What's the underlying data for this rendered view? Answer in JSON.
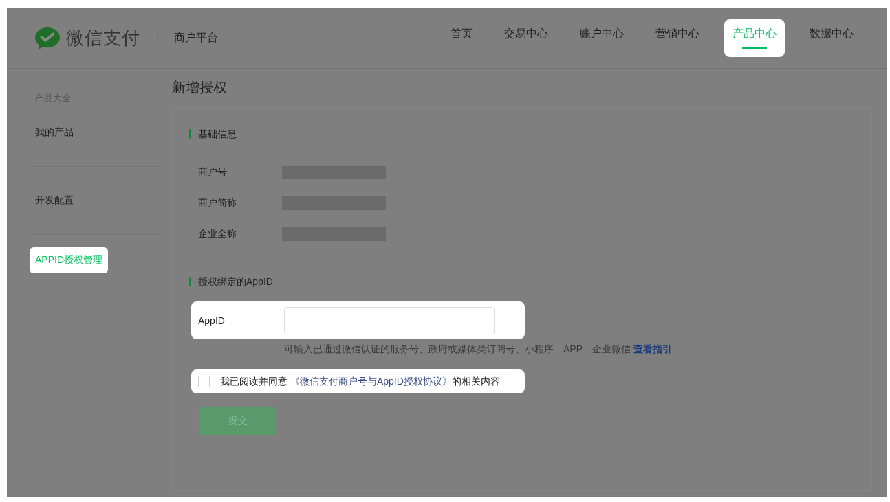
{
  "header": {
    "brand": "微信支付",
    "platform": "商户平台",
    "nav": [
      {
        "label": "首页",
        "selected": false,
        "highlighted": false
      },
      {
        "label": "交易中心",
        "selected": false,
        "highlighted": false
      },
      {
        "label": "账户中心",
        "selected": false,
        "highlighted": false
      },
      {
        "label": "营销中心",
        "selected": false,
        "highlighted": false
      },
      {
        "label": "产品中心",
        "selected": true,
        "highlighted": true
      },
      {
        "label": "数据中心",
        "selected": false,
        "highlighted": false
      }
    ]
  },
  "sidebar": {
    "heading": "产品大全",
    "groups": [
      [
        {
          "label": "我的产品",
          "selected": false,
          "highlighted": false
        }
      ],
      [
        {
          "label": "开发配置",
          "selected": false,
          "highlighted": false
        }
      ],
      [
        {
          "label": "APPID授权管理",
          "selected": true,
          "highlighted": true
        }
      ]
    ]
  },
  "page": {
    "title": "新增授权",
    "basic_section": {
      "title": "基础信息",
      "fields": [
        {
          "label": "商户号"
        },
        {
          "label": "商户简称"
        },
        {
          "label": "企业全称"
        }
      ]
    },
    "appid_section": {
      "title": "授权绑定的AppID",
      "field": {
        "label": "AppID",
        "highlighted": true
      },
      "hint": "可输入已通过微信认证的服务号、政府或媒体类订阅号、小程序、APP、企业微信",
      "hint_link": "查看指引"
    },
    "agreement": {
      "checked": false,
      "highlighted": true,
      "before": "我已阅读并同意",
      "link": "《微信支付商户号与AppID授权协议》",
      "after": "的相关内容"
    },
    "submit": {
      "label": "提交",
      "disabled": true
    }
  }
}
